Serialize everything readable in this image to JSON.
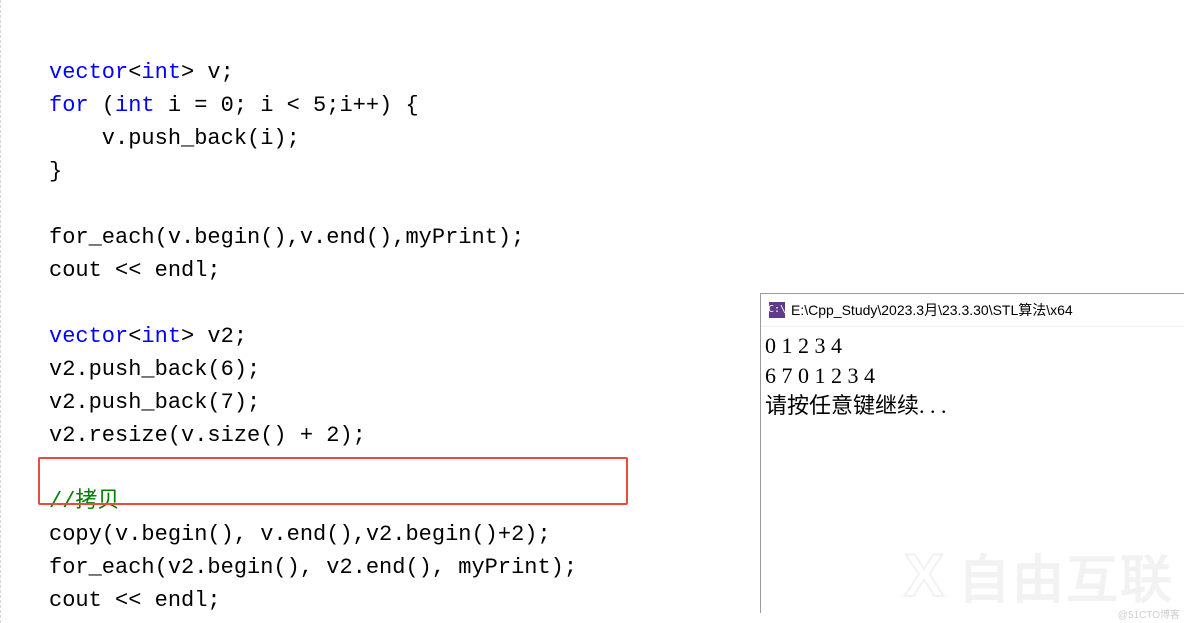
{
  "editor": {
    "lines": [
      {
        "tokens": [
          {
            "c": "kw",
            "t": "vector"
          },
          {
            "c": "br",
            "t": "<"
          },
          {
            "c": "kw",
            "t": "int"
          },
          {
            "c": "br",
            "t": ">"
          },
          {
            "c": "op",
            "t": " v;"
          }
        ]
      },
      {
        "tokens": [
          {
            "c": "kw",
            "t": "for"
          },
          {
            "c": "op",
            "t": " ("
          },
          {
            "c": "kw",
            "t": "int"
          },
          {
            "c": "op",
            "t": " i = 0; i < 5;i++) {"
          }
        ]
      },
      {
        "indent": 1,
        "tokens": [
          {
            "c": "op",
            "t": "    v.push_back(i);"
          }
        ]
      },
      {
        "tokens": [
          {
            "c": "op",
            "t": "}"
          }
        ]
      },
      {
        "tokens": []
      },
      {
        "tokens": [
          {
            "c": "op",
            "t": "for_each(v.begin(),v.end(),myPrint);"
          }
        ]
      },
      {
        "tokens": [
          {
            "c": "op",
            "t": "cout << endl;"
          }
        ]
      },
      {
        "tokens": []
      },
      {
        "tokens": [
          {
            "c": "kw",
            "t": "vector"
          },
          {
            "c": "br",
            "t": "<"
          },
          {
            "c": "kw",
            "t": "int"
          },
          {
            "c": "br",
            "t": ">"
          },
          {
            "c": "op",
            "t": " v2;"
          }
        ]
      },
      {
        "highlight": true,
        "tokens": [
          {
            "c": "op",
            "t": "v2.push_back(6);"
          }
        ]
      },
      {
        "tokens": [
          {
            "c": "op",
            "t": "v2.push_back(7);"
          }
        ]
      },
      {
        "tokens": [
          {
            "c": "op",
            "t": "v2.resize(v.size() + 2);"
          }
        ]
      },
      {
        "tokens": []
      },
      {
        "tokens": [
          {
            "c": "cmt",
            "t": "//拷贝"
          }
        ]
      },
      {
        "tokens": [
          {
            "c": "op",
            "t": "copy(v.begin(), v.end(),v2.begin()+2);"
          }
        ]
      },
      {
        "tokens": [
          {
            "c": "op",
            "t": "for_each(v2.begin(), v2.end(), myPrint);"
          }
        ]
      },
      {
        "tokens": [
          {
            "c": "op",
            "t": "cout << endl;"
          }
        ]
      }
    ],
    "highlighted_box_line_index": 14
  },
  "console": {
    "icon_label": "C:\\",
    "title": "E:\\Cpp_Study\\2023.3月\\23.3.30\\STL算法\\x64",
    "output_lines": [
      "0 1 2 3 4",
      "6 7 0 1 2 3 4",
      "请按任意键继续. . ."
    ]
  },
  "watermark_text": "自由互联",
  "attribution_text": "@51CTO博客"
}
